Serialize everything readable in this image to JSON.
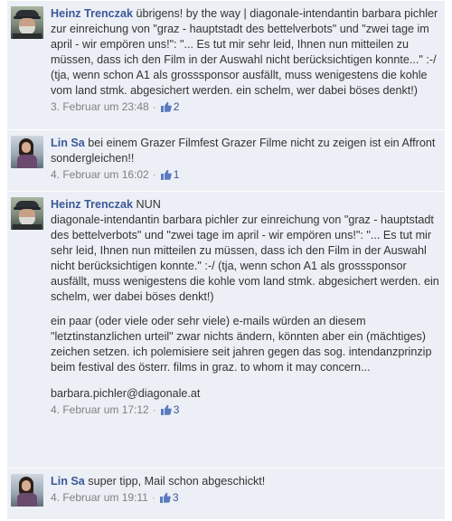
{
  "colors": {
    "background": "#eceff5",
    "link": "#3b5998",
    "text": "#333333",
    "timestamp": "#808080"
  },
  "like_icon": "thumbs-up-icon",
  "comments": [
    {
      "author": "Heinz Trenczak",
      "text": "übrigens! by the way | diagonale-intendantin barbara pichler zur einreichung von \"graz - hauptstadt des bettelverbots\" und \"zwei tage im april - wir empören uns!\": \"... Es tut mir sehr leid, Ihnen nun mitteilen zu müssen, dass ich den Film in der Auswahl nicht berücksichtigen konnte...\" :-/ (tja, wenn schon A1 als grosssponsor ausfällt, muss wenigestens die kohle vom land stmk. abgesichert werden. ein schelm, wer dabei böses denkt!)",
      "timestamp": "3. Februar um 23:48",
      "likes": "2"
    },
    {
      "author": "Lin Sa",
      "text": "bei einem Grazer Filmfest Grazer Filme nicht zu zeigen ist ein Affront sondergleichen!!",
      "timestamp": "4. Februar um 16:02",
      "likes": "1"
    },
    {
      "author": "Heinz Trenczak",
      "text": "NUN",
      "paragraphs": [
        "diagonale-intendantin barbara pichler zur einreichung von \"graz - hauptstadt des bettelverbots\" und \"zwei tage im april - wir empören uns!\": \"... Es tut mir sehr leid, Ihnen nun mitteilen zu müssen, dass ich den Film in der Auswahl nicht berücksichtigen konnte.\" :-/ (tja, wenn schon A1 als grosssponsor ausfällt, muss wenigestens die kohle vom land stmk. abgesichert werden. ein schelm, wer dabei böses denkt!)",
        "ein paar (oder viele oder sehr viele) e-mails würden an diesem \"letztinstanzlichen urteil\" zwar nichts ändern, könnten aber ein (mächtiges) zeichen setzen. ich polemisiere seit jahren gegen das sog. intendanzprinzip beim festival des österr. films in graz. to whom it may concern..."
      ],
      "email": "barbara.pichler@diagonale.at",
      "timestamp": "4. Februar um 17:12",
      "likes": "3"
    },
    {
      "author": "Lin Sa",
      "text": "super tipp, Mail schon abgeschickt!",
      "timestamp": "4. Februar um 19:11",
      "likes": "3"
    }
  ]
}
